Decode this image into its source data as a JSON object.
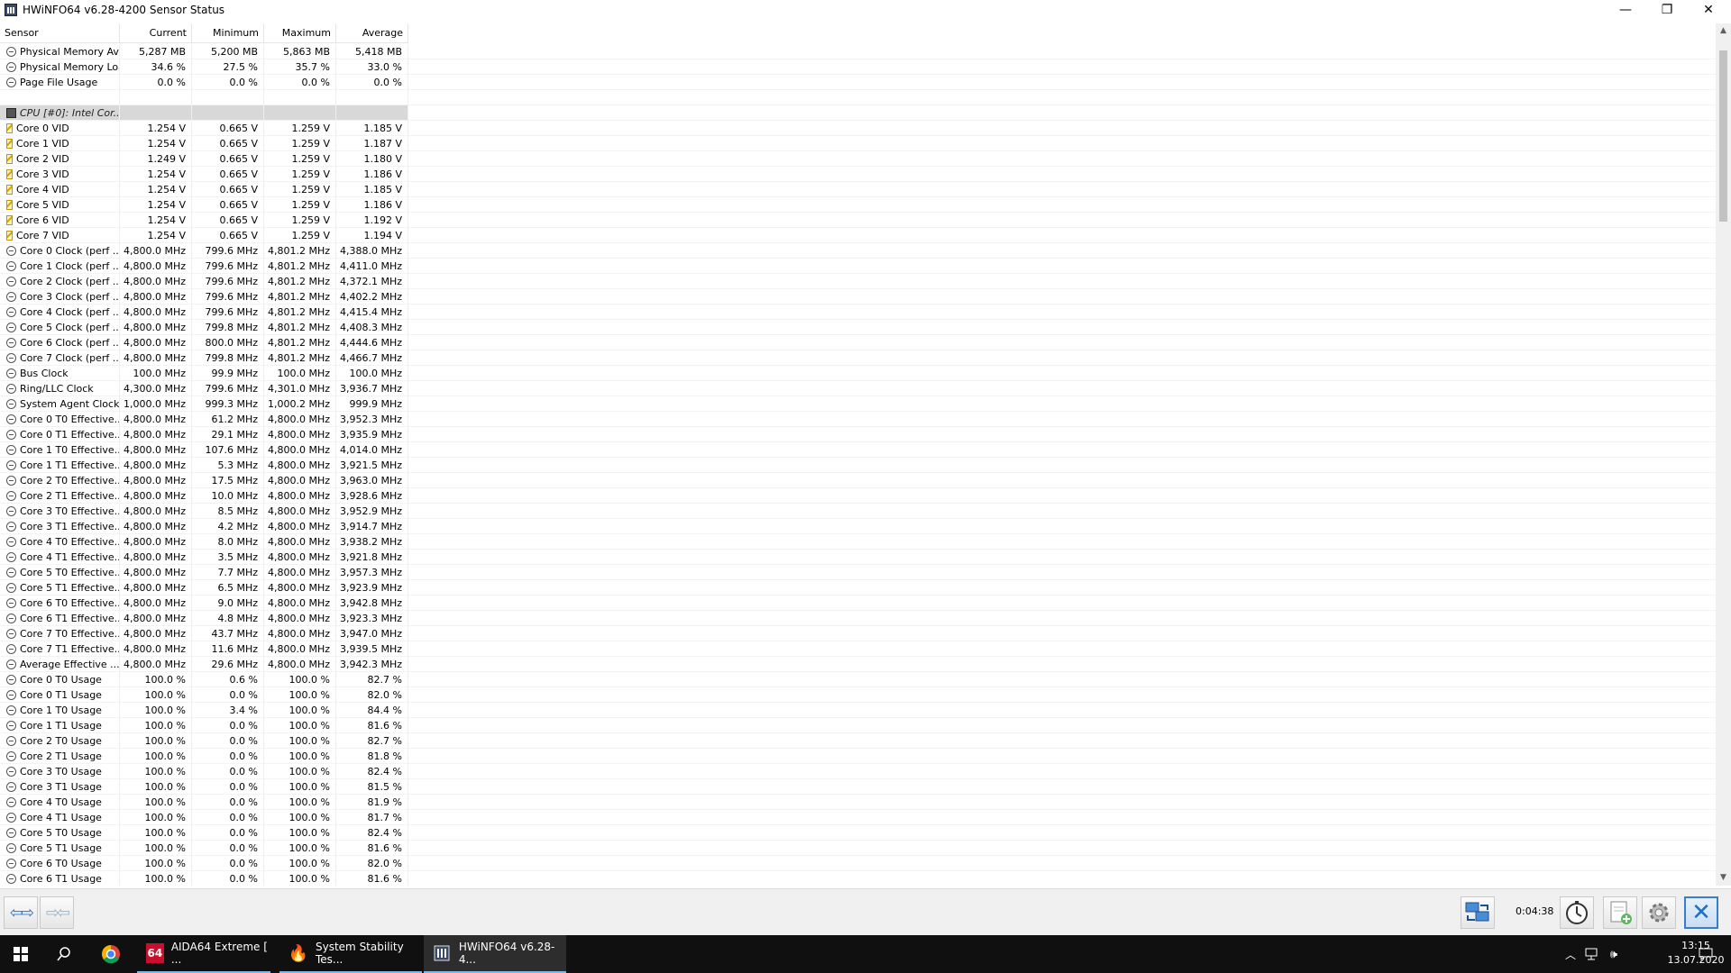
{
  "window": {
    "title": "HWiNFO64 v6.28-4200 Sensor Status",
    "minimize": "—",
    "restore": "❐",
    "close": "✕"
  },
  "columns": [
    "Sensor",
    "Current",
    "Minimum",
    "Maximum",
    "Average"
  ],
  "rows": [
    {
      "icon": "clock-icon",
      "name": "Physical Memory Av...",
      "cur": "5,287 MB",
      "min": "5,200 MB",
      "max": "5,863 MB",
      "avg": "5,418 MB"
    },
    {
      "icon": "clock-icon",
      "name": "Physical Memory Load",
      "cur": "34.6 %",
      "min": "27.5 %",
      "max": "35.7 %",
      "avg": "33.0 %"
    },
    {
      "icon": "clock-icon",
      "name": "Page File Usage",
      "cur": "0.0 %",
      "min": "0.0 %",
      "max": "0.0 %",
      "avg": "0.0 %"
    },
    {
      "icon": "none",
      "name": "",
      "cur": "",
      "min": "",
      "max": "",
      "avg": ""
    },
    {
      "icon": "chip-icon",
      "name": "CPU [#0]: Intel Cor...",
      "cur": "",
      "min": "",
      "max": "",
      "avg": "",
      "group": true
    },
    {
      "icon": "voltage-icon",
      "name": "Core 0 VID",
      "cur": "1.254 V",
      "min": "0.665 V",
      "max": "1.259 V",
      "avg": "1.185 V"
    },
    {
      "icon": "voltage-icon",
      "name": "Core 1 VID",
      "cur": "1.254 V",
      "min": "0.665 V",
      "max": "1.259 V",
      "avg": "1.187 V"
    },
    {
      "icon": "voltage-icon",
      "name": "Core 2 VID",
      "cur": "1.249 V",
      "min": "0.665 V",
      "max": "1.259 V",
      "avg": "1.180 V"
    },
    {
      "icon": "voltage-icon",
      "name": "Core 3 VID",
      "cur": "1.254 V",
      "min": "0.665 V",
      "max": "1.259 V",
      "avg": "1.186 V"
    },
    {
      "icon": "voltage-icon",
      "name": "Core 4 VID",
      "cur": "1.254 V",
      "min": "0.665 V",
      "max": "1.259 V",
      "avg": "1.185 V"
    },
    {
      "icon": "voltage-icon",
      "name": "Core 5 VID",
      "cur": "1.254 V",
      "min": "0.665 V",
      "max": "1.259 V",
      "avg": "1.186 V"
    },
    {
      "icon": "voltage-icon",
      "name": "Core 6 VID",
      "cur": "1.254 V",
      "min": "0.665 V",
      "max": "1.259 V",
      "avg": "1.192 V"
    },
    {
      "icon": "voltage-icon",
      "name": "Core 7 VID",
      "cur": "1.254 V",
      "min": "0.665 V",
      "max": "1.259 V",
      "avg": "1.194 V"
    },
    {
      "icon": "clock-icon",
      "name": "Core 0 Clock (perf ...",
      "cur": "4,800.0 MHz",
      "min": "799.6 MHz",
      "max": "4,801.2 MHz",
      "avg": "4,388.0 MHz"
    },
    {
      "icon": "clock-icon",
      "name": "Core 1 Clock (perf ...",
      "cur": "4,800.0 MHz",
      "min": "799.6 MHz",
      "max": "4,801.2 MHz",
      "avg": "4,411.0 MHz"
    },
    {
      "icon": "clock-icon",
      "name": "Core 2 Clock (perf ...",
      "cur": "4,800.0 MHz",
      "min": "799.6 MHz",
      "max": "4,801.2 MHz",
      "avg": "4,372.1 MHz"
    },
    {
      "icon": "clock-icon",
      "name": "Core 3 Clock (perf ...",
      "cur": "4,800.0 MHz",
      "min": "799.6 MHz",
      "max": "4,801.2 MHz",
      "avg": "4,402.2 MHz"
    },
    {
      "icon": "clock-icon",
      "name": "Core 4 Clock (perf ...",
      "cur": "4,800.0 MHz",
      "min": "799.6 MHz",
      "max": "4,801.2 MHz",
      "avg": "4,415.4 MHz"
    },
    {
      "icon": "clock-icon",
      "name": "Core 5 Clock (perf ...",
      "cur": "4,800.0 MHz",
      "min": "799.8 MHz",
      "max": "4,801.2 MHz",
      "avg": "4,408.3 MHz"
    },
    {
      "icon": "clock-icon",
      "name": "Core 6 Clock (perf ...",
      "cur": "4,800.0 MHz",
      "min": "800.0 MHz",
      "max": "4,801.2 MHz",
      "avg": "4,444.6 MHz"
    },
    {
      "icon": "clock-icon",
      "name": "Core 7 Clock (perf ...",
      "cur": "4,800.0 MHz",
      "min": "799.8 MHz",
      "max": "4,801.2 MHz",
      "avg": "4,466.7 MHz"
    },
    {
      "icon": "clock-icon",
      "name": "Bus Clock",
      "cur": "100.0 MHz",
      "min": "99.9 MHz",
      "max": "100.0 MHz",
      "avg": "100.0 MHz"
    },
    {
      "icon": "clock-icon",
      "name": "Ring/LLC Clock",
      "cur": "4,300.0 MHz",
      "min": "799.6 MHz",
      "max": "4,301.0 MHz",
      "avg": "3,936.7 MHz"
    },
    {
      "icon": "clock-icon",
      "name": "System Agent Clock",
      "cur": "1,000.0 MHz",
      "min": "999.3 MHz",
      "max": "1,000.2 MHz",
      "avg": "999.9 MHz"
    },
    {
      "icon": "clock-icon",
      "name": "Core 0 T0 Effective...",
      "cur": "4,800.0 MHz",
      "min": "61.2 MHz",
      "max": "4,800.0 MHz",
      "avg": "3,952.3 MHz"
    },
    {
      "icon": "clock-icon",
      "name": "Core 0 T1 Effective...",
      "cur": "4,800.0 MHz",
      "min": "29.1 MHz",
      "max": "4,800.0 MHz",
      "avg": "3,935.9 MHz"
    },
    {
      "icon": "clock-icon",
      "name": "Core 1 T0 Effective...",
      "cur": "4,800.0 MHz",
      "min": "107.6 MHz",
      "max": "4,800.0 MHz",
      "avg": "4,014.0 MHz"
    },
    {
      "icon": "clock-icon",
      "name": "Core 1 T1 Effective...",
      "cur": "4,800.0 MHz",
      "min": "5.3 MHz",
      "max": "4,800.0 MHz",
      "avg": "3,921.5 MHz"
    },
    {
      "icon": "clock-icon",
      "name": "Core 2 T0 Effective...",
      "cur": "4,800.0 MHz",
      "min": "17.5 MHz",
      "max": "4,800.0 MHz",
      "avg": "3,963.0 MHz"
    },
    {
      "icon": "clock-icon",
      "name": "Core 2 T1 Effective...",
      "cur": "4,800.0 MHz",
      "min": "10.0 MHz",
      "max": "4,800.0 MHz",
      "avg": "3,928.6 MHz"
    },
    {
      "icon": "clock-icon",
      "name": "Core 3 T0 Effective...",
      "cur": "4,800.0 MHz",
      "min": "8.5 MHz",
      "max": "4,800.0 MHz",
      "avg": "3,952.9 MHz"
    },
    {
      "icon": "clock-icon",
      "name": "Core 3 T1 Effective...",
      "cur": "4,800.0 MHz",
      "min": "4.2 MHz",
      "max": "4,800.0 MHz",
      "avg": "3,914.7 MHz"
    },
    {
      "icon": "clock-icon",
      "name": "Core 4 T0 Effective...",
      "cur": "4,800.0 MHz",
      "min": "8.0 MHz",
      "max": "4,800.0 MHz",
      "avg": "3,938.2 MHz"
    },
    {
      "icon": "clock-icon",
      "name": "Core 4 T1 Effective...",
      "cur": "4,800.0 MHz",
      "min": "3.5 MHz",
      "max": "4,800.0 MHz",
      "avg": "3,921.8 MHz"
    },
    {
      "icon": "clock-icon",
      "name": "Core 5 T0 Effective...",
      "cur": "4,800.0 MHz",
      "min": "7.7 MHz",
      "max": "4,800.0 MHz",
      "avg": "3,957.3 MHz"
    },
    {
      "icon": "clock-icon",
      "name": "Core 5 T1 Effective...",
      "cur": "4,800.0 MHz",
      "min": "6.5 MHz",
      "max": "4,800.0 MHz",
      "avg": "3,923.9 MHz"
    },
    {
      "icon": "clock-icon",
      "name": "Core 6 T0 Effective...",
      "cur": "4,800.0 MHz",
      "min": "9.0 MHz",
      "max": "4,800.0 MHz",
      "avg": "3,942.8 MHz"
    },
    {
      "icon": "clock-icon",
      "name": "Core 6 T1 Effective...",
      "cur": "4,800.0 MHz",
      "min": "4.8 MHz",
      "max": "4,800.0 MHz",
      "avg": "3,923.3 MHz"
    },
    {
      "icon": "clock-icon",
      "name": "Core 7 T0 Effective...",
      "cur": "4,800.0 MHz",
      "min": "43.7 MHz",
      "max": "4,800.0 MHz",
      "avg": "3,947.0 MHz"
    },
    {
      "icon": "clock-icon",
      "name": "Core 7 T1 Effective...",
      "cur": "4,800.0 MHz",
      "min": "11.6 MHz",
      "max": "4,800.0 MHz",
      "avg": "3,939.5 MHz"
    },
    {
      "icon": "clock-icon",
      "name": "Average Effective ...",
      "cur": "4,800.0 MHz",
      "min": "29.6 MHz",
      "max": "4,800.0 MHz",
      "avg": "3,942.3 MHz"
    },
    {
      "icon": "clock-icon",
      "name": "Core 0 T0 Usage",
      "cur": "100.0 %",
      "min": "0.6 %",
      "max": "100.0 %",
      "avg": "82.7 %"
    },
    {
      "icon": "clock-icon",
      "name": "Core 0 T1 Usage",
      "cur": "100.0 %",
      "min": "0.0 %",
      "max": "100.0 %",
      "avg": "82.0 %"
    },
    {
      "icon": "clock-icon",
      "name": "Core 1 T0 Usage",
      "cur": "100.0 %",
      "min": "3.4 %",
      "max": "100.0 %",
      "avg": "84.4 %"
    },
    {
      "icon": "clock-icon",
      "name": "Core 1 T1 Usage",
      "cur": "100.0 %",
      "min": "0.0 %",
      "max": "100.0 %",
      "avg": "81.6 %"
    },
    {
      "icon": "clock-icon",
      "name": "Core 2 T0 Usage",
      "cur": "100.0 %",
      "min": "0.0 %",
      "max": "100.0 %",
      "avg": "82.7 %"
    },
    {
      "icon": "clock-icon",
      "name": "Core 2 T1 Usage",
      "cur": "100.0 %",
      "min": "0.0 %",
      "max": "100.0 %",
      "avg": "81.8 %"
    },
    {
      "icon": "clock-icon",
      "name": "Core 3 T0 Usage",
      "cur": "100.0 %",
      "min": "0.0 %",
      "max": "100.0 %",
      "avg": "82.4 %"
    },
    {
      "icon": "clock-icon",
      "name": "Core 3 T1 Usage",
      "cur": "100.0 %",
      "min": "0.0 %",
      "max": "100.0 %",
      "avg": "81.5 %"
    },
    {
      "icon": "clock-icon",
      "name": "Core 4 T0 Usage",
      "cur": "100.0 %",
      "min": "0.0 %",
      "max": "100.0 %",
      "avg": "81.9 %"
    },
    {
      "icon": "clock-icon",
      "name": "Core 4 T1 Usage",
      "cur": "100.0 %",
      "min": "0.0 %",
      "max": "100.0 %",
      "avg": "81.7 %"
    },
    {
      "icon": "clock-icon",
      "name": "Core 5 T0 Usage",
      "cur": "100.0 %",
      "min": "0.0 %",
      "max": "100.0 %",
      "avg": "82.4 %"
    },
    {
      "icon": "clock-icon",
      "name": "Core 5 T1 Usage",
      "cur": "100.0 %",
      "min": "0.0 %",
      "max": "100.0 %",
      "avg": "81.6 %"
    },
    {
      "icon": "clock-icon",
      "name": "Core 6 T0 Usage",
      "cur": "100.0 %",
      "min": "0.0 %",
      "max": "100.0 %",
      "avg": "82.0 %"
    },
    {
      "icon": "clock-icon",
      "name": "Core 6 T1 Usage",
      "cur": "100.0 %",
      "min": "0.0 %",
      "max": "100.0 %",
      "avg": "81.6 %"
    }
  ],
  "toolbar": {
    "timer": "0:04:38",
    "nav_icons": [
      "expand-arrows-icon",
      "collapse-arrows-icon"
    ],
    "button_icons": [
      "network-icon",
      "clock-icon",
      "add-report-icon",
      "settings-gear-icon",
      "close-x-icon"
    ],
    "accent": "#2f74c8"
  },
  "taskbar": {
    "tasks": [
      {
        "name": "aida64",
        "label": "AIDA64 Extreme  [ ...",
        "icon_text": "64",
        "icon_color": "#c8102e"
      },
      {
        "name": "stability",
        "label": "System Stability Tes...",
        "icon_text": "🔥",
        "icon_color": "transparent"
      },
      {
        "name": "hwinfo",
        "label": "HWiNFO64 v6.28-4...",
        "icon_text": "",
        "icon_color": "#3a4a6a"
      }
    ],
    "time": "13:15",
    "date": "13.07.2020"
  }
}
